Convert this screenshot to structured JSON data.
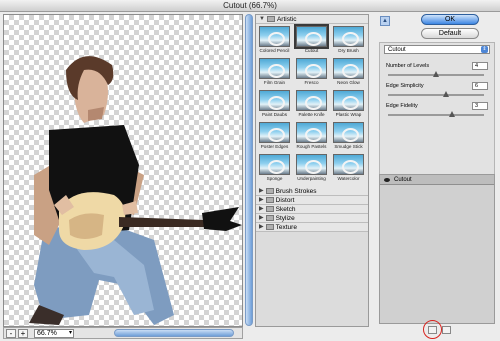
{
  "window": {
    "title": "Cutout (66.7%)"
  },
  "status": {
    "zoom": "66.7%",
    "zoom_minus": "-",
    "zoom_plus": "+"
  },
  "gallery": {
    "categories_top": [
      {
        "label": "Artistic",
        "expanded": true
      }
    ],
    "artistic_filters": [
      {
        "label": "Colored Pencil",
        "selected": false
      },
      {
        "label": "Cutout",
        "selected": true
      },
      {
        "label": "Dry Brush",
        "selected": false
      },
      {
        "label": "Film Grain",
        "selected": false
      },
      {
        "label": "Fresco",
        "selected": false
      },
      {
        "label": "Neon Glow",
        "selected": false
      },
      {
        "label": "Paint Daubs",
        "selected": false
      },
      {
        "label": "Palette Knife",
        "selected": false
      },
      {
        "label": "Plastic Wrap",
        "selected": false
      },
      {
        "label": "Poster Edges",
        "selected": false
      },
      {
        "label": "Rough Pastels",
        "selected": false
      },
      {
        "label": "Smudge Stick",
        "selected": false
      },
      {
        "label": "Sponge",
        "selected": false
      },
      {
        "label": "Underpainting",
        "selected": false
      },
      {
        "label": "Watercolor",
        "selected": false
      }
    ],
    "categories_collapsed": [
      {
        "label": "Brush Strokes"
      },
      {
        "label": "Distort"
      },
      {
        "label": "Sketch"
      },
      {
        "label": "Stylize"
      },
      {
        "label": "Texture"
      }
    ]
  },
  "buttons": {
    "ok": "OK",
    "default": "Default",
    "collapse": "▲"
  },
  "settings": {
    "filter_select": "Cutout",
    "params": [
      {
        "label": "Number of Levels",
        "value": "4",
        "slider": 0.5
      },
      {
        "label": "Edge Simplicity",
        "value": "6",
        "slider": 0.6
      },
      {
        "label": "Edge Fidelity",
        "value": "3",
        "slider": 0.67
      }
    ]
  },
  "layers": {
    "items": [
      {
        "label": "Cutout"
      }
    ]
  },
  "colors": {
    "ok_blue": "#3d86e3",
    "highlight_ring": "#d8241f"
  }
}
